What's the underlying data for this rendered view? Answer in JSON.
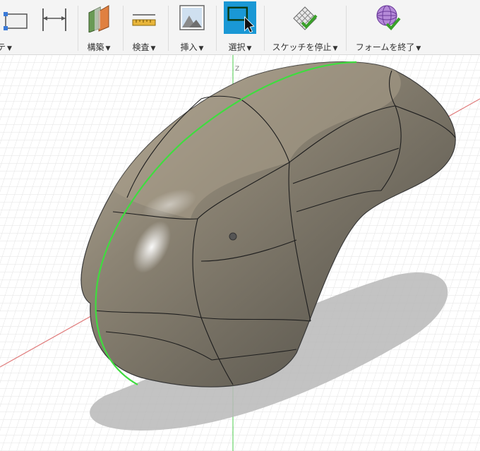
{
  "toolbar": {
    "modify_partial": "モディファイ",
    "modify_visible": "テ",
    "create_label": "構築",
    "inspect_label": "検査",
    "insert_label": "挿入",
    "select_label": "選択",
    "stop_sketch_label": "スケッチを停止",
    "finish_form_label": "フォームを終了",
    "caret": "▼"
  },
  "viewport": {
    "axis_label": "Z"
  },
  "colors": {
    "select_active": "#1a98d5",
    "model_body": "#7a7465",
    "selection_edge": "#3fdc3f",
    "axis_red": "#e07a7a",
    "axis_green": "#6ad46a"
  }
}
